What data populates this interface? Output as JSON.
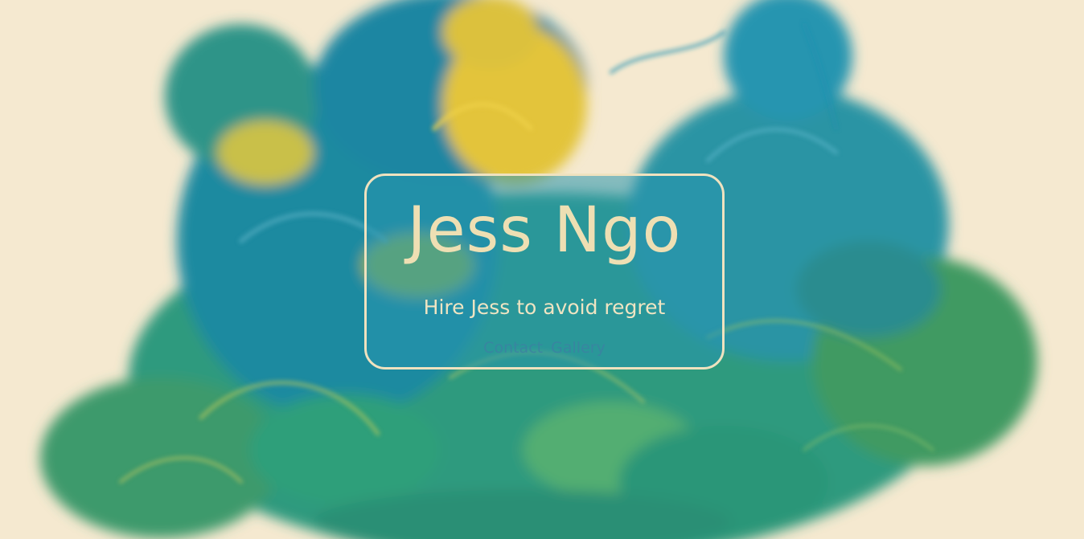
{
  "hero": {
    "name": "Jess Ngo",
    "tagline": "Hire Jess to avoid regret"
  },
  "nav": {
    "items": [
      {
        "label": "Contact"
      },
      {
        "label": "Gallery"
      }
    ]
  },
  "colors": {
    "background": "#f5e9d0",
    "card_border": "#efe2bf",
    "title_text": "#eedfb3",
    "ink_teal": "#1f8fa6",
    "ink_green": "#3fa874",
    "ink_yellow": "#e6c83a"
  }
}
